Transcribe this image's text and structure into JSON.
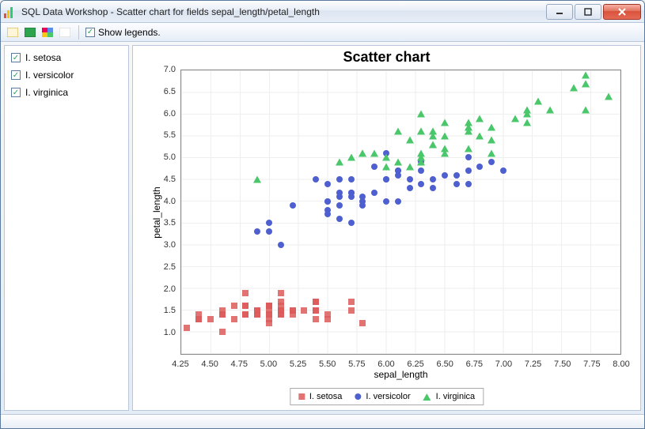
{
  "window": {
    "title": "SQL Data Workshop - Scatter chart for fields sepal_length/petal_length"
  },
  "toolbar": {
    "show_legends_label": "Show legends."
  },
  "sidebar": {
    "items": [
      {
        "label": "I. setosa",
        "checked": true
      },
      {
        "label": "I. versicolor",
        "checked": true
      },
      {
        "label": "I. virginica",
        "checked": true
      }
    ]
  },
  "legend": {
    "items": [
      {
        "label": "I. setosa"
      },
      {
        "label": "I. versicolor"
      },
      {
        "label": "I. virginica"
      }
    ]
  },
  "chart_data": {
    "type": "scatter",
    "title": "Scatter chart",
    "xlabel": "sepal_length",
    "ylabel": "petal_length",
    "xlim": [
      4.25,
      8.0
    ],
    "ylim": [
      0.5,
      7.0
    ],
    "xticks": [
      4.25,
      4.5,
      4.75,
      5.0,
      5.25,
      5.5,
      5.75,
      6.0,
      6.25,
      6.5,
      6.75,
      7.0,
      7.25,
      7.5,
      7.75,
      8.0
    ],
    "yticks": [
      1.0,
      1.5,
      2.0,
      2.5,
      3.0,
      3.5,
      4.0,
      4.5,
      5.0,
      5.5,
      6.0,
      6.5,
      7.0
    ],
    "series": [
      {
        "name": "I. setosa",
        "marker": "square",
        "color": "#dc5a5a",
        "points": [
          [
            5.1,
            1.4
          ],
          [
            4.9,
            1.4
          ],
          [
            4.7,
            1.3
          ],
          [
            4.6,
            1.5
          ],
          [
            5.0,
            1.4
          ],
          [
            5.4,
            1.7
          ],
          [
            4.6,
            1.4
          ],
          [
            5.0,
            1.5
          ],
          [
            4.4,
            1.4
          ],
          [
            4.9,
            1.5
          ],
          [
            5.4,
            1.5
          ],
          [
            4.8,
            1.6
          ],
          [
            4.8,
            1.4
          ],
          [
            4.3,
            1.1
          ],
          [
            5.8,
            1.2
          ],
          [
            5.7,
            1.5
          ],
          [
            5.4,
            1.3
          ],
          [
            5.1,
            1.4
          ],
          [
            5.7,
            1.7
          ],
          [
            5.1,
            1.5
          ],
          [
            5.4,
            1.7
          ],
          [
            5.1,
            1.5
          ],
          [
            4.6,
            1.0
          ],
          [
            5.1,
            1.7
          ],
          [
            4.8,
            1.9
          ],
          [
            5.0,
            1.6
          ],
          [
            5.0,
            1.6
          ],
          [
            5.2,
            1.5
          ],
          [
            5.2,
            1.4
          ],
          [
            4.7,
            1.6
          ],
          [
            4.8,
            1.6
          ],
          [
            5.4,
            1.5
          ],
          [
            5.2,
            1.5
          ],
          [
            5.5,
            1.4
          ],
          [
            4.9,
            1.5
          ],
          [
            5.0,
            1.2
          ],
          [
            5.5,
            1.3
          ],
          [
            4.9,
            1.4
          ],
          [
            4.4,
            1.3
          ],
          [
            5.1,
            1.5
          ],
          [
            5.0,
            1.3
          ],
          [
            4.5,
            1.3
          ],
          [
            4.4,
            1.3
          ],
          [
            5.0,
            1.6
          ],
          [
            5.1,
            1.9
          ],
          [
            4.8,
            1.4
          ],
          [
            5.1,
            1.6
          ],
          [
            4.6,
            1.4
          ],
          [
            5.3,
            1.5
          ],
          [
            5.0,
            1.4
          ]
        ]
      },
      {
        "name": "I. versicolor",
        "marker": "circle",
        "color": "#4e5fcf",
        "points": [
          [
            7.0,
            4.7
          ],
          [
            6.4,
            4.5
          ],
          [
            6.9,
            4.9
          ],
          [
            5.5,
            4.0
          ],
          [
            6.5,
            4.6
          ],
          [
            5.7,
            4.5
          ],
          [
            6.3,
            4.7
          ],
          [
            4.9,
            3.3
          ],
          [
            6.6,
            4.6
          ],
          [
            5.2,
            3.9
          ],
          [
            5.0,
            3.5
          ],
          [
            5.9,
            4.2
          ],
          [
            6.0,
            4.0
          ],
          [
            6.1,
            4.7
          ],
          [
            5.6,
            3.6
          ],
          [
            6.7,
            4.4
          ],
          [
            5.6,
            4.5
          ],
          [
            5.8,
            4.1
          ],
          [
            6.2,
            4.5
          ],
          [
            5.6,
            3.9
          ],
          [
            5.9,
            4.8
          ],
          [
            6.1,
            4.0
          ],
          [
            6.3,
            4.9
          ],
          [
            6.1,
            4.7
          ],
          [
            6.4,
            4.3
          ],
          [
            6.6,
            4.4
          ],
          [
            6.8,
            4.8
          ],
          [
            6.7,
            5.0
          ],
          [
            6.0,
            4.5
          ],
          [
            5.7,
            3.5
          ],
          [
            5.5,
            3.8
          ],
          [
            5.5,
            3.7
          ],
          [
            5.8,
            3.9
          ],
          [
            6.0,
            5.1
          ],
          [
            5.4,
            4.5
          ],
          [
            6.0,
            4.5
          ],
          [
            6.7,
            4.7
          ],
          [
            6.3,
            4.4
          ],
          [
            5.6,
            4.1
          ],
          [
            5.5,
            4.0
          ],
          [
            5.5,
            4.4
          ],
          [
            6.1,
            4.6
          ],
          [
            5.8,
            4.0
          ],
          [
            5.0,
            3.3
          ],
          [
            5.6,
            4.2
          ],
          [
            5.7,
            4.2
          ],
          [
            5.7,
            4.2
          ],
          [
            6.2,
            4.3
          ],
          [
            5.1,
            3.0
          ],
          [
            5.7,
            4.1
          ]
        ]
      },
      {
        "name": "I. virginica",
        "marker": "triangle",
        "color": "#4ac76a",
        "points": [
          [
            6.3,
            6.0
          ],
          [
            5.8,
            5.1
          ],
          [
            7.1,
            5.9
          ],
          [
            6.3,
            5.6
          ],
          [
            6.5,
            5.8
          ],
          [
            7.6,
            6.6
          ],
          [
            4.9,
            4.5
          ],
          [
            7.3,
            6.3
          ],
          [
            6.7,
            5.8
          ],
          [
            7.2,
            6.1
          ],
          [
            6.5,
            5.1
          ],
          [
            6.4,
            5.3
          ],
          [
            6.8,
            5.5
          ],
          [
            5.7,
            5.0
          ],
          [
            5.8,
            5.1
          ],
          [
            6.4,
            5.3
          ],
          [
            6.5,
            5.5
          ],
          [
            7.7,
            6.7
          ],
          [
            7.7,
            6.9
          ],
          [
            6.0,
            5.0
          ],
          [
            6.9,
            5.7
          ],
          [
            5.6,
            4.9
          ],
          [
            7.7,
            6.7
          ],
          [
            6.3,
            4.9
          ],
          [
            6.7,
            5.7
          ],
          [
            7.2,
            6.0
          ],
          [
            6.2,
            4.8
          ],
          [
            6.1,
            4.9
          ],
          [
            6.4,
            5.6
          ],
          [
            7.2,
            5.8
          ],
          [
            7.4,
            6.1
          ],
          [
            7.9,
            6.4
          ],
          [
            6.4,
            5.6
          ],
          [
            6.3,
            5.1
          ],
          [
            6.1,
            5.6
          ],
          [
            7.7,
            6.1
          ],
          [
            6.3,
            5.6
          ],
          [
            6.4,
            5.5
          ],
          [
            6.0,
            4.8
          ],
          [
            6.9,
            5.4
          ],
          [
            6.7,
            5.6
          ],
          [
            6.9,
            5.1
          ],
          [
            5.8,
            5.1
          ],
          [
            6.8,
            5.9
          ],
          [
            6.7,
            5.7
          ],
          [
            6.7,
            5.2
          ],
          [
            6.3,
            5.0
          ],
          [
            6.5,
            5.2
          ],
          [
            6.2,
            5.4
          ],
          [
            5.9,
            5.1
          ]
        ]
      }
    ]
  }
}
